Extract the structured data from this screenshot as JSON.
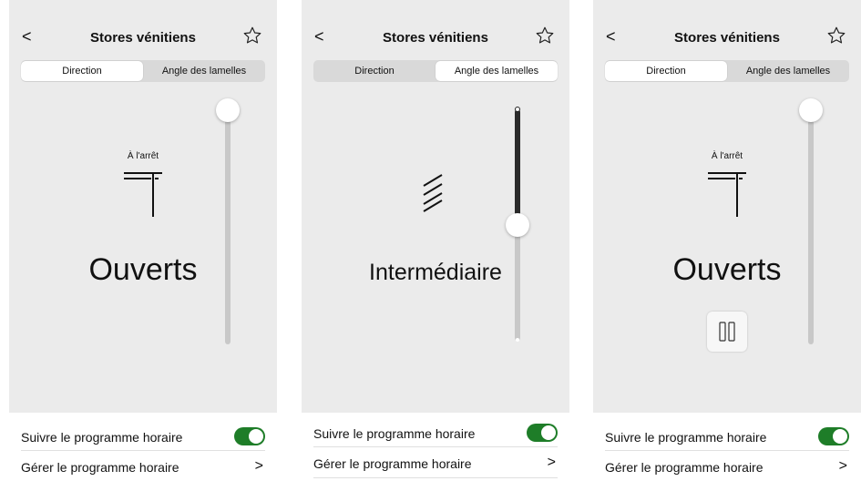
{
  "screens": [
    {
      "title": "Stores vénitiens",
      "back_glyph": "<",
      "star_icon": "star-outline-icon",
      "tabs": [
        {
          "label": "Direction"
        },
        {
          "label": "Angle des lamelles"
        }
      ],
      "active_tab": 0,
      "status_small": "À l'arrêt",
      "state_label": "Ouverts",
      "slider_value": 1.0,
      "schedule_follow_label": "Suivre le programme horaire",
      "schedule_manage_label": "Gérer le programme horaire",
      "toggle_on": true,
      "chevron_glyph": ">"
    },
    {
      "title": "Stores vénitiens",
      "back_glyph": "<",
      "star_icon": "star-outline-icon",
      "tabs": [
        {
          "label": "Direction"
        },
        {
          "label": "Angle des lamelles"
        }
      ],
      "active_tab": 1,
      "state_label": "Intermédiaire",
      "slider_value": 0.5,
      "schedule_follow_label": "Suivre le programme horaire",
      "schedule_manage_label": "Gérer le programme horaire",
      "toggle_on": true,
      "chevron_glyph": ">"
    },
    {
      "title": "Stores vénitiens",
      "back_glyph": "<",
      "star_icon": "star-outline-icon",
      "tabs": [
        {
          "label": "Direction"
        },
        {
          "label": "Angle des lamelles"
        }
      ],
      "active_tab": 0,
      "status_small": "À l'arrêt",
      "state_label": "Ouverts",
      "slider_value": 1.0,
      "pause_icon": "pause-icon",
      "schedule_follow_label": "Suivre le programme horaire",
      "schedule_manage_label": "Gérer le programme horaire",
      "toggle_on": true,
      "chevron_glyph": ">"
    }
  ],
  "colors": {
    "panel_bg": "#ebebeb",
    "toggle_on": "#1e7d28",
    "segment_bg": "#d9d9d9"
  }
}
